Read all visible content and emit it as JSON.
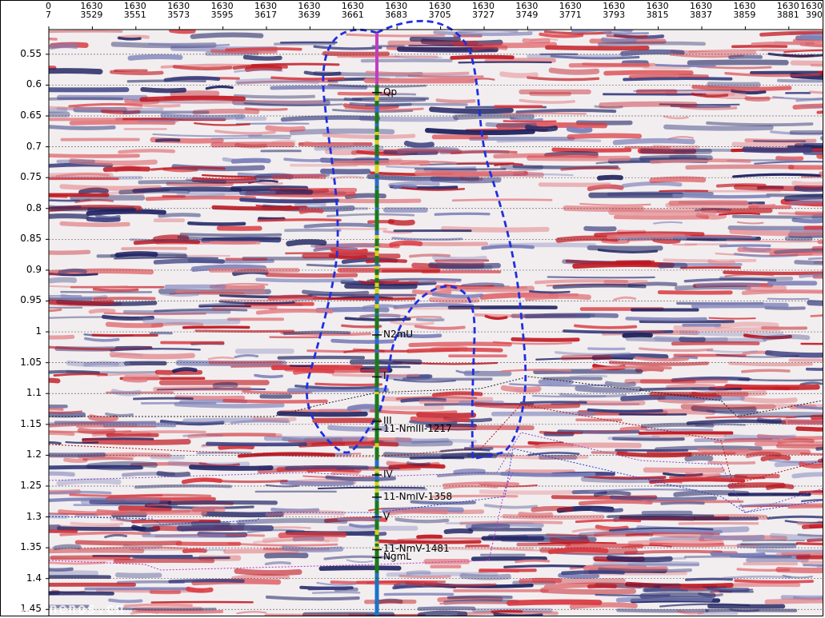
{
  "xaxis": {
    "ticks": [
      {
        "top": "0",
        "bottom": "7"
      },
      {
        "top": "1630",
        "bottom": "3529"
      },
      {
        "top": "1630",
        "bottom": "3551"
      },
      {
        "top": "1630",
        "bottom": "3573"
      },
      {
        "top": "1630",
        "bottom": "3595"
      },
      {
        "top": "1630",
        "bottom": "3617"
      },
      {
        "top": "1630",
        "bottom": "3639"
      },
      {
        "top": "1630",
        "bottom": "3661"
      },
      {
        "top": "1630",
        "bottom": "3683"
      },
      {
        "top": "1630",
        "bottom": "3705"
      },
      {
        "top": "1630",
        "bottom": "3727"
      },
      {
        "top": "1630",
        "bottom": "3749"
      },
      {
        "top": "1630",
        "bottom": "3771"
      },
      {
        "top": "1630",
        "bottom": "3793"
      },
      {
        "top": "1630",
        "bottom": "3815"
      },
      {
        "top": "1630",
        "bottom": "3837"
      },
      {
        "top": "1630",
        "bottom": "3859"
      },
      {
        "top": "1630",
        "bottom": "3881"
      },
      {
        "top": "1630",
        "bottom": "390"
      }
    ]
  },
  "yaxis": {
    "ticks": [
      "0.55",
      "0.6",
      "0.65",
      "0.7",
      "0.75",
      "0.8",
      "0.85",
      "0.9",
      "0.95",
      "1",
      "1.05",
      "1.1",
      "1.15",
      "1.2",
      "1.25",
      "1.3",
      "1.35",
      "1.4",
      "1.45"
    ],
    "range": [
      0.51,
      1.46
    ]
  },
  "well_markers": [
    {
      "label": "Qp",
      "t": 0.612
    },
    {
      "label": "N2mU",
      "t": 1.005
    },
    {
      "label": "I",
      "t": 1.073
    },
    {
      "label": "III",
      "t": 1.145
    },
    {
      "label": "11-NmIII-1217",
      "t": 1.158
    },
    {
      "label": "IV",
      "t": 1.232
    },
    {
      "label": "11-NmIV-1358",
      "t": 1.268
    },
    {
      "label": "V",
      "t": 1.3
    },
    {
      "label": "11-NmV-1481",
      "t": 1.353
    },
    {
      "label": "NgmL",
      "t": 1.366
    }
  ],
  "watermark": "www.cnenos.cn",
  "colors": {
    "positive": "#c0161e",
    "negative": "#1b1f5e",
    "well_track": "#1a7a1a",
    "well_top": "#c23bc2",
    "outline": "#1f2fe0"
  }
}
